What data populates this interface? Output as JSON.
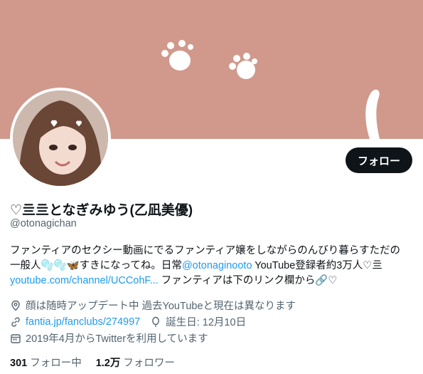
{
  "profile": {
    "display_name": "♡亖亖となぎみゆう(乙凪美優)",
    "handle": "@otonagichan",
    "follow_button": "フォロー"
  },
  "bio": {
    "line1": "ファンティアのセクシー動画にでるファンティア嬢をしながらのんびり暮らすただの",
    "line2_pre": "一般人🫧🫧🦋すきになってね。日常",
    "line2_mention": "@otonaginooto",
    "line2_post": " YouTube登録者約3万人♡亖",
    "line3_link": "youtube.com/channel/UCCohF...",
    "line3_post": " ファンティアは下のリンク欄から🔗♡"
  },
  "meta": {
    "location": "顔は随時アップデート中 過去YouTubeと現在は異なります",
    "url": "fantia.jp/fanclubs/274997",
    "birthday": "誕生日: 12月10日",
    "joined": "2019年4月からTwitterを利用しています"
  },
  "stats": {
    "following_count": "301",
    "following_label": "フォロー中",
    "followers_count": "1.2万",
    "followers_label": "フォロワー"
  },
  "colors": {
    "banner": "#d0998c",
    "link": "#1d9bf0",
    "button_bg": "#0f1419",
    "secondary_text": "#536471"
  },
  "icons": [
    "location-icon",
    "link-icon",
    "balloon-icon",
    "calendar-icon"
  ]
}
